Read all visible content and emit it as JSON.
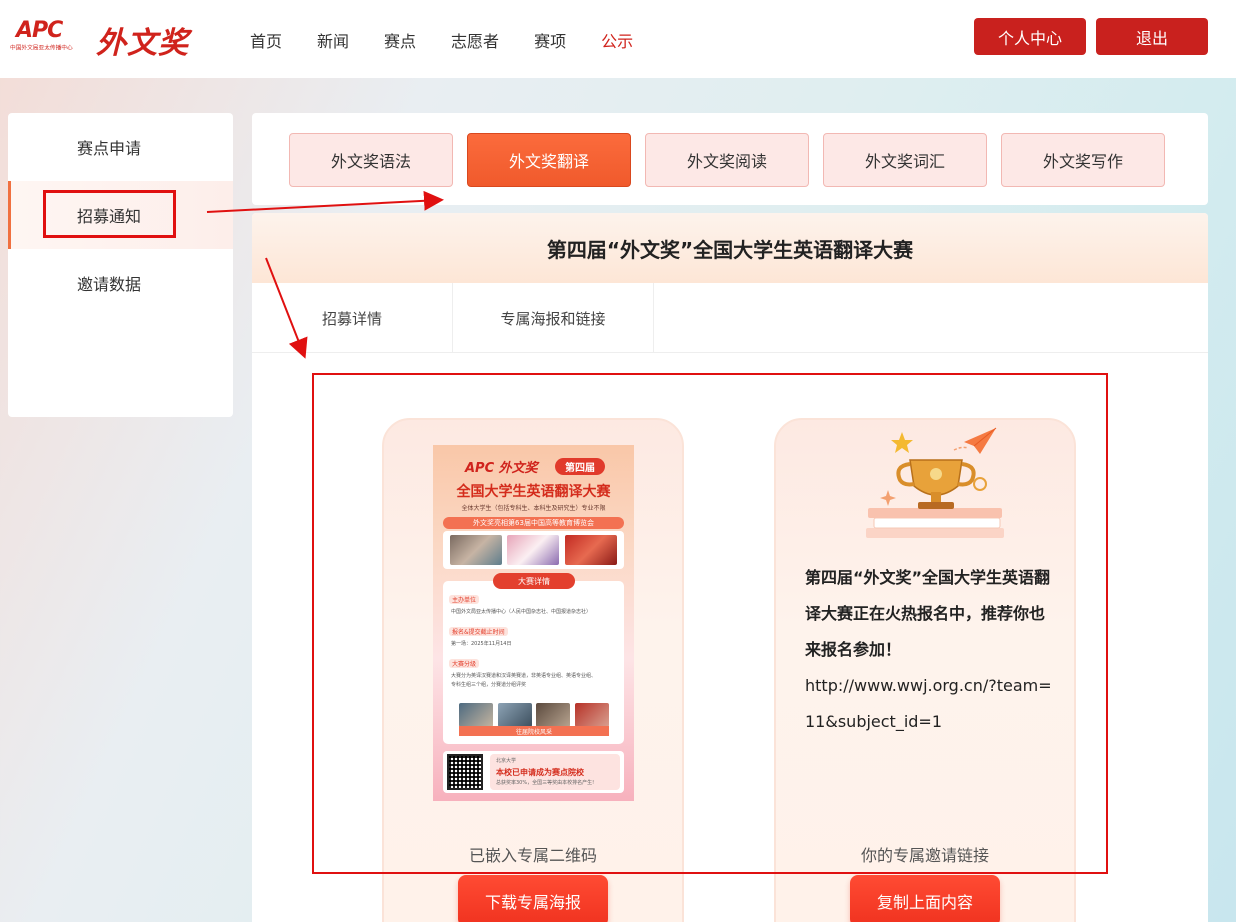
{
  "header": {
    "logo_apc": "APC",
    "logo_apc_sub": "中国外文局亚太传播中心",
    "logo_brand": "外文奖",
    "nav": [
      "首页",
      "新闻",
      "赛点",
      "志愿者",
      "赛项",
      "公示"
    ],
    "active_nav": "公示",
    "btn_profile": "个人中心",
    "btn_logout": "退出"
  },
  "sidebar": {
    "items": [
      {
        "label": "赛点申请"
      },
      {
        "label": "招募通知"
      },
      {
        "label": "邀请数据"
      }
    ],
    "active": "招募通知"
  },
  "subject_tabs": [
    "外文奖语法",
    "外文奖翻译",
    "外文奖阅读",
    "外文奖词汇",
    "外文奖写作"
  ],
  "active_subject": "外文奖翻译",
  "main": {
    "title": "第四届“外文奖”全国大学生英语翻译大赛",
    "sub_tabs": [
      "招募详情",
      "专属海报和链接"
    ]
  },
  "poster": {
    "logo": "APC 外文奖",
    "badge": "第四届",
    "title": "全国大学生英语翻译大赛",
    "line1": "全体大学生（包括专科生、本科生及研究生）专业不限",
    "banner": "外文奖亮相第63届中国高等教育博览会",
    "details_head": "大赛详情",
    "label_org": "主办单位",
    "text_org": "中国外文局亚太传播中心（人民中国杂志社、中国报道杂志社）",
    "label_deadline": "报名&提交截止时间",
    "text_deadline": "第一场：2025年11月14日",
    "label_groups": "大赛分级",
    "text_groups1": "大赛分为英译汉赛道和汉译英赛道，非英语专业组、英语专业组、",
    "text_groups2": "专科生组三个组，分赛道分组评奖",
    "strip": "往届院校风采",
    "foot_school": "北京大学",
    "foot_big": "本校已申请成为赛点院校",
    "foot_small": "总获奖率30%，全国三等奖由本校排名产生!"
  },
  "left_panel": {
    "caption": "已嵌入专属二维码",
    "button": "下载专属海报"
  },
  "right_panel": {
    "invite_text": "第四届“外文奖”全国大学生英语翻译大赛正在火热报名中，推荐你也来报名参加！",
    "invite_link": "http://www.wwj.org.cn/?team=11&subject_id=1",
    "caption": "你的专属邀请链接",
    "button": "复制上面内容"
  },
  "colors": {
    "brand_red": "#c9211e",
    "active_orange": "#f05a2c",
    "annotation_red": "#e01010"
  }
}
